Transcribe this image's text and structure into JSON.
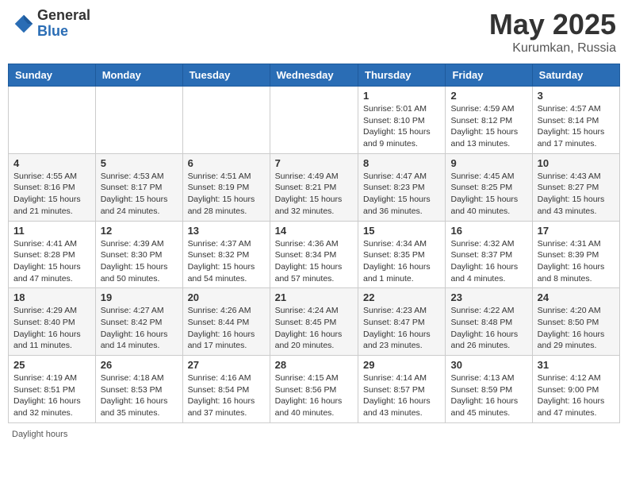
{
  "header": {
    "logo_general": "General",
    "logo_blue": "Blue",
    "title_month": "May 2025",
    "title_location": "Kurumkan, Russia"
  },
  "days_of_week": [
    "Sunday",
    "Monday",
    "Tuesday",
    "Wednesday",
    "Thursday",
    "Friday",
    "Saturday"
  ],
  "weeks": [
    [
      {
        "num": "",
        "info": ""
      },
      {
        "num": "",
        "info": ""
      },
      {
        "num": "",
        "info": ""
      },
      {
        "num": "",
        "info": ""
      },
      {
        "num": "1",
        "info": "Sunrise: 5:01 AM\nSunset: 8:10 PM\nDaylight: 15 hours\nand 9 minutes."
      },
      {
        "num": "2",
        "info": "Sunrise: 4:59 AM\nSunset: 8:12 PM\nDaylight: 15 hours\nand 13 minutes."
      },
      {
        "num": "3",
        "info": "Sunrise: 4:57 AM\nSunset: 8:14 PM\nDaylight: 15 hours\nand 17 minutes."
      }
    ],
    [
      {
        "num": "4",
        "info": "Sunrise: 4:55 AM\nSunset: 8:16 PM\nDaylight: 15 hours\nand 21 minutes."
      },
      {
        "num": "5",
        "info": "Sunrise: 4:53 AM\nSunset: 8:17 PM\nDaylight: 15 hours\nand 24 minutes."
      },
      {
        "num": "6",
        "info": "Sunrise: 4:51 AM\nSunset: 8:19 PM\nDaylight: 15 hours\nand 28 minutes."
      },
      {
        "num": "7",
        "info": "Sunrise: 4:49 AM\nSunset: 8:21 PM\nDaylight: 15 hours\nand 32 minutes."
      },
      {
        "num": "8",
        "info": "Sunrise: 4:47 AM\nSunset: 8:23 PM\nDaylight: 15 hours\nand 36 minutes."
      },
      {
        "num": "9",
        "info": "Sunrise: 4:45 AM\nSunset: 8:25 PM\nDaylight: 15 hours\nand 40 minutes."
      },
      {
        "num": "10",
        "info": "Sunrise: 4:43 AM\nSunset: 8:27 PM\nDaylight: 15 hours\nand 43 minutes."
      }
    ],
    [
      {
        "num": "11",
        "info": "Sunrise: 4:41 AM\nSunset: 8:28 PM\nDaylight: 15 hours\nand 47 minutes."
      },
      {
        "num": "12",
        "info": "Sunrise: 4:39 AM\nSunset: 8:30 PM\nDaylight: 15 hours\nand 50 minutes."
      },
      {
        "num": "13",
        "info": "Sunrise: 4:37 AM\nSunset: 8:32 PM\nDaylight: 15 hours\nand 54 minutes."
      },
      {
        "num": "14",
        "info": "Sunrise: 4:36 AM\nSunset: 8:34 PM\nDaylight: 15 hours\nand 57 minutes."
      },
      {
        "num": "15",
        "info": "Sunrise: 4:34 AM\nSunset: 8:35 PM\nDaylight: 16 hours\nand 1 minute."
      },
      {
        "num": "16",
        "info": "Sunrise: 4:32 AM\nSunset: 8:37 PM\nDaylight: 16 hours\nand 4 minutes."
      },
      {
        "num": "17",
        "info": "Sunrise: 4:31 AM\nSunset: 8:39 PM\nDaylight: 16 hours\nand 8 minutes."
      }
    ],
    [
      {
        "num": "18",
        "info": "Sunrise: 4:29 AM\nSunset: 8:40 PM\nDaylight: 16 hours\nand 11 minutes."
      },
      {
        "num": "19",
        "info": "Sunrise: 4:27 AM\nSunset: 8:42 PM\nDaylight: 16 hours\nand 14 minutes."
      },
      {
        "num": "20",
        "info": "Sunrise: 4:26 AM\nSunset: 8:44 PM\nDaylight: 16 hours\nand 17 minutes."
      },
      {
        "num": "21",
        "info": "Sunrise: 4:24 AM\nSunset: 8:45 PM\nDaylight: 16 hours\nand 20 minutes."
      },
      {
        "num": "22",
        "info": "Sunrise: 4:23 AM\nSunset: 8:47 PM\nDaylight: 16 hours\nand 23 minutes."
      },
      {
        "num": "23",
        "info": "Sunrise: 4:22 AM\nSunset: 8:48 PM\nDaylight: 16 hours\nand 26 minutes."
      },
      {
        "num": "24",
        "info": "Sunrise: 4:20 AM\nSunset: 8:50 PM\nDaylight: 16 hours\nand 29 minutes."
      }
    ],
    [
      {
        "num": "25",
        "info": "Sunrise: 4:19 AM\nSunset: 8:51 PM\nDaylight: 16 hours\nand 32 minutes."
      },
      {
        "num": "26",
        "info": "Sunrise: 4:18 AM\nSunset: 8:53 PM\nDaylight: 16 hours\nand 35 minutes."
      },
      {
        "num": "27",
        "info": "Sunrise: 4:16 AM\nSunset: 8:54 PM\nDaylight: 16 hours\nand 37 minutes."
      },
      {
        "num": "28",
        "info": "Sunrise: 4:15 AM\nSunset: 8:56 PM\nDaylight: 16 hours\nand 40 minutes."
      },
      {
        "num": "29",
        "info": "Sunrise: 4:14 AM\nSunset: 8:57 PM\nDaylight: 16 hours\nand 43 minutes."
      },
      {
        "num": "30",
        "info": "Sunrise: 4:13 AM\nSunset: 8:59 PM\nDaylight: 16 hours\nand 45 minutes."
      },
      {
        "num": "31",
        "info": "Sunrise: 4:12 AM\nSunset: 9:00 PM\nDaylight: 16 hours\nand 47 minutes."
      }
    ]
  ],
  "footer": {
    "daylight_label": "Daylight hours"
  }
}
